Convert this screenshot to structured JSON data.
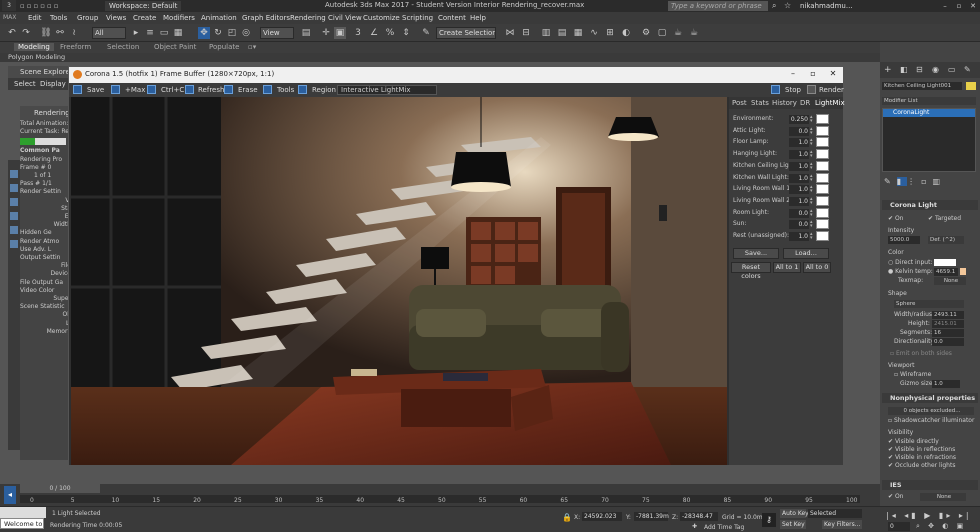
{
  "titlebar": {
    "workspace": "Workspace: Default",
    "title": "Autodesk 3ds Max 2017 - Student Version   Interior Rendering_recover.max",
    "search_placeholder": "Type a keyword or phrase",
    "user": "nikahmadmu..."
  },
  "menu": [
    "Edit",
    "Tools",
    "Group",
    "Views",
    "Create",
    "Modifiers",
    "Animation",
    "Graph Editors",
    "Rendering",
    "Civil View",
    "Customize",
    "Scripting",
    "Content",
    "Help"
  ],
  "toolbar": {
    "filter": "All",
    "view": "View",
    "selection_set": "Create Selection Se"
  },
  "ribbon": {
    "tabs": [
      "Modeling",
      "Freeform",
      "Selection",
      "Object Paint",
      "Populate"
    ],
    "sub": "Polygon Modeling"
  },
  "scene_explorer": {
    "title": "Scene Explorer - L",
    "select": "Select",
    "display": "Display"
  },
  "render_panel": {
    "title": "Rendering",
    "lines": [
      "Total Animation:",
      "",
      "Current Task:   Re",
      "",
      "",
      "Common Pa",
      "Rendering Pro",
      "Frame # 0",
      "1 of 1",
      "Pass # 1/1",
      "",
      "Render Settin",
      "Vi",
      "Sta",
      "Er",
      "Width",
      "Hidden Ge",
      "Render Atmo",
      "Use Adv. L",
      "",
      "Output Settin",
      "File",
      "Device",
      "File Output Ga",
      "Video Color",
      "Super",
      "",
      "Scene Statistic",
      "Ob",
      "Li",
      "Memory"
    ]
  },
  "frame_buffer": {
    "title": "Corona 1.5 (hotfix 1) Frame Buffer (1280×720px, 1:1)",
    "toolbar": [
      "Save",
      "+Max",
      "Ctrl+C",
      "Refresh",
      "Erase",
      "Tools",
      "Region"
    ],
    "lightmix_dropdown": "Interactive LightMix",
    "stop": "Stop",
    "render": "Render",
    "tabs": [
      "Post",
      "Stats",
      "History",
      "DR",
      "LightMix"
    ],
    "lightmix": [
      {
        "label": "Environment:",
        "value": "0.250"
      },
      {
        "label": "Attic Light:",
        "value": "0.0"
      },
      {
        "label": "Floor Lamp:",
        "value": "1.0"
      },
      {
        "label": "Hanging Light:",
        "value": "1.0"
      },
      {
        "label": "Kitchen Ceiling Light:",
        "value": "1.0"
      },
      {
        "label": "Kitchen Wall Light:",
        "value": "1.0"
      },
      {
        "label": "Living Room Wall 1:",
        "value": "1.0"
      },
      {
        "label": "Living Room Wall 2:",
        "value": "1.0"
      },
      {
        "label": "Room Light:",
        "value": "0.0"
      },
      {
        "label": "Sun:",
        "value": "0.0"
      },
      {
        "label": "Rest (unassigned):",
        "value": "1.0"
      }
    ],
    "save_btn": "Save...",
    "load_btn": "Load...",
    "reset_btn": "Reset colors",
    "all1_btn": "All to 1",
    "all0_btn": "All to 0"
  },
  "command_panel": {
    "object_name": "Kitchen Ceiling Light001",
    "modifier_list": "Modifier List",
    "stack_item": "CoronaLight",
    "section": "Corona Light",
    "on": "On",
    "targeted": "Targeted",
    "intensity_label": "Intensity",
    "intensity": "5000.0",
    "intensity_unit": "Def. (^2)",
    "color_label": "Color",
    "direct_input": "Direct input:",
    "kelvin": "Kelvin temp:",
    "kelvin_value": "4659.1",
    "texmap": "Texmap:",
    "texmap_value": "None",
    "shape_label": "Shape",
    "shape": "Sphere",
    "width_radius_label": "Width/radius:",
    "width_radius": "2493.11",
    "height_label": "Height:",
    "height": "2415.01",
    "segments_label": "Segments:",
    "segments": "16",
    "directionality_label": "Directionality:",
    "directionality": "0.0",
    "emit": "Emit on both sides",
    "viewport": "Viewport",
    "wireframe": "Wireframe",
    "gizmo_label": "Gizmo size:",
    "gizmo": "1.0",
    "nonphys": "Nonphysical properties",
    "excluded": "0 objects excluded...",
    "shadowcatcher": "Shadowcatcher illuminator",
    "visibility": "Visibility",
    "vis_items": [
      "Visible directly",
      "Visible in reflections",
      "Visible in refractions",
      "Occlude other lights"
    ],
    "ies": "IES",
    "ies_on": "On",
    "ies_value": "None"
  },
  "timeline": {
    "frame": "0 / 100",
    "ticks": [
      "0",
      "5",
      "10",
      "15",
      "20",
      "25",
      "30",
      "35",
      "40",
      "45",
      "50",
      "55",
      "60",
      "65",
      "70",
      "75",
      "80",
      "85",
      "90",
      "95",
      "100"
    ]
  },
  "status": {
    "welcome": "Welcome to",
    "selected": "1 Light Selected",
    "render_time": "Rendering Time  0:00:05",
    "x_label": "X:",
    "x": "24592.023",
    "y_label": "Y:",
    "y": "-7881.39m",
    "z_label": "Z:",
    "z": "-28348.47",
    "grid": "Grid = 10.0mm",
    "auto_key": "Auto Key",
    "selected_dd": "Selected",
    "set_key": "Set Key",
    "key_filters": "Key Filters...",
    "add_time_tag": "Add Time Tag",
    "frame_num": "0"
  }
}
